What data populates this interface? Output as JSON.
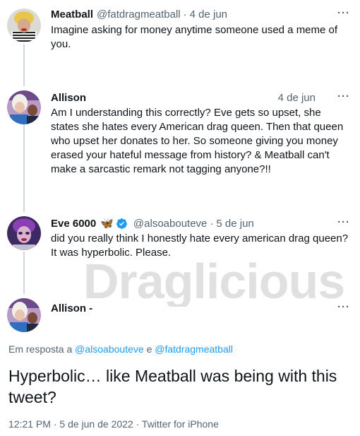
{
  "thread": [
    {
      "name": "Meatball",
      "handle": "@fatdragmeatball",
      "sep": "·",
      "date": "4 de jun",
      "text": "Imagine asking for money anytime someone used a meme of you."
    },
    {
      "name": "Allison",
      "date": "4 de jun",
      "text": "Am I understanding this correctly? Eve gets so upset, she states she hates every American drag queen. Then that queen who upset her donates to her. So someone giving you money erased your hateful message from history? & Meatball can't make a sarcastic remark not tagging anyone?!!"
    },
    {
      "name": "Eve 6000",
      "emoji": "🦋",
      "handle": "@alsoabouteve",
      "sep": "·",
      "date": "5 de jun",
      "text": "did you really think I honestly hate every american drag queen? It was hyperbolic. Please."
    }
  ],
  "focused": {
    "name": "Allison -",
    "reply_prefix": "Em resposta a",
    "reply_user_1": "@alsoabouteve",
    "reply_conj": "e",
    "reply_user_2": "@fatdragmeatball",
    "text": "Hyperbolic… like Meatball was being with this tweet?",
    "time": "12:21 PM",
    "meta_sep": "·",
    "date": "5 de jun de 2022",
    "source": "Twitter for iPhone"
  },
  "more_label": "···",
  "watermark": "Draglicious",
  "icons": {
    "more": "more-horizontal-icon",
    "verified": "verified-badge-icon"
  },
  "colors": {
    "text": "#0f1419",
    "secondary": "#536471",
    "link": "#1d9bf0",
    "thread_line": "#cfd9de"
  }
}
